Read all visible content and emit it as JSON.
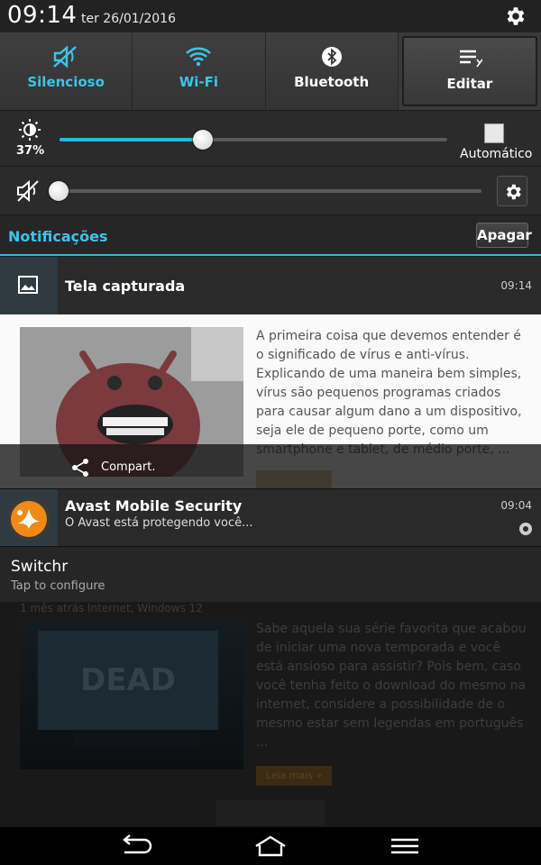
{
  "status": {
    "time": "09:14",
    "date": "ter 26/01/2016"
  },
  "quick_settings": {
    "tiles": [
      {
        "label": "Silencioso",
        "icon": "mute-icon",
        "active": true
      },
      {
        "label": "Wi-Fi",
        "icon": "wifi-icon",
        "active": true
      },
      {
        "label": "Bluetooth",
        "icon": "bluetooth-icon",
        "active": false
      },
      {
        "label": "Editar",
        "icon": "edit-list-icon",
        "active": false
      }
    ]
  },
  "brightness": {
    "percent_label": "37%",
    "level": 0.37,
    "auto_label": "Automático",
    "auto_checked": false
  },
  "volume": {
    "level": 0.0
  },
  "notifications": {
    "header": "Notificações",
    "clear_label": "Apagar",
    "items": [
      {
        "title": "Tela capturada",
        "time": "09:14",
        "share_label": "Compart."
      },
      {
        "title": "Avast Mobile Security",
        "subtitle": "O Avast está protegendo você...",
        "time": "09:04"
      },
      {
        "title": "Switchr",
        "subtitle": "Tap to configure"
      }
    ]
  },
  "article_preview": {
    "text": "A primeira coisa que devemos entender é o significado de vírus e anti-vírus. Explicando de uma maneira bem simples, vírus são pequenos programas criados para causar algum dano a um dispositivo, seja ele de pequeno porte, como um smartphone e tablet, de médio porte, ...",
    "read_more": "Leia mais »"
  },
  "background_article": {
    "meta": "1 mês atrás   Internet, Windows   12",
    "text": "Sabe aquela sua série favorita que acabou de iniciar uma nova temporada e você está ansioso para assistir? Pois bem, caso você tenha feito o download do mesmo na internet, considere a possibilidade de o mesmo estar sem legendas em português ...",
    "read_more": "Leia mais »",
    "thumb_text": "DEAD"
  },
  "colors": {
    "accent": "#3cc4ea",
    "slider_fill": "#2bb5e3"
  }
}
